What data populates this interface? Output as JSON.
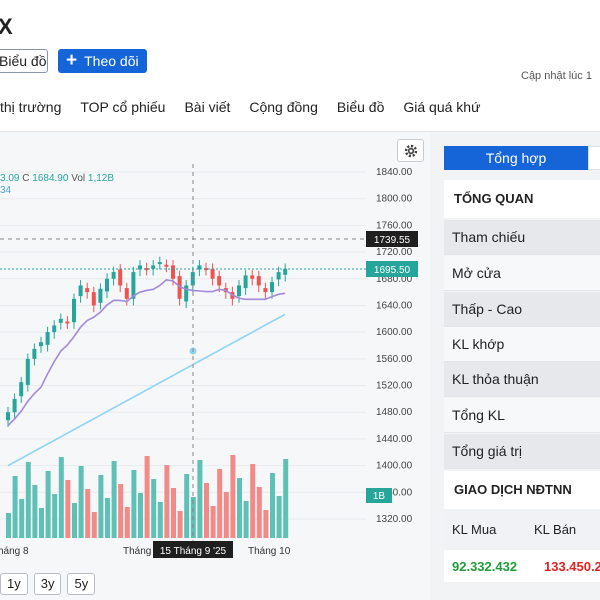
{
  "header": {
    "title": "X",
    "chart_button": "Biểu đồ",
    "follow_button": "Theo dõi",
    "updated_label": "Cập nhật lúc  1"
  },
  "nav": [
    "thị trường",
    "TOP cổ phiếu",
    "Bài viết",
    "Cộng đồng",
    "Biểu đồ",
    "Giá quá khứ"
  ],
  "chart": {
    "ohlc_left": "3.09",
    "ohlc_c_label": "C",
    "ohlc_c_value": "1684.90",
    "vol_label": "Vol",
    "vol_value": "1,12B",
    "ma_value": "34",
    "y_ticks": [
      "1840.00",
      "1800.00",
      "1760.00",
      "1720.00",
      "1680.00",
      "1640.00",
      "1600.00",
      "1560.00",
      "1520.00",
      "1480.00",
      "1440.00",
      "1400.00",
      "1360.00",
      "1320.00"
    ],
    "crosshair_price": "1739.55",
    "last_price": "1695.50",
    "volume_tag": "1B",
    "x_labels": [
      "háng 8",
      "Tháng",
      "Tháng 10"
    ],
    "crosshair_date": "15 Tháng 9 '25",
    "range_buttons": [
      "1y",
      "3y",
      "5y"
    ],
    "colors": {
      "up": "#26a69a",
      "down": "#ef5350",
      "ma_short": "#a48ad8",
      "ma_long": "#8fd3f4",
      "accent": "#1565d8"
    }
  },
  "panel": {
    "active_tab": "Tổng hợp",
    "overview_title": "TỔNG QUAN",
    "overview_rows": [
      "Tham chiếu",
      "Mở cửa",
      "Thấp - Cao",
      "KL khớp",
      "KL thỏa thuận",
      "Tổng KL",
      "Tổng giá trị"
    ],
    "foreign_title": "GIAO DỊCH NĐTNN",
    "buy_label": "KL Mua",
    "sell_label": "KL Bán",
    "buy_value": "92.332.432",
    "sell_value": "133.450.2",
    "buy_color": "#1e9e3a",
    "sell_color": "#e02424"
  }
}
